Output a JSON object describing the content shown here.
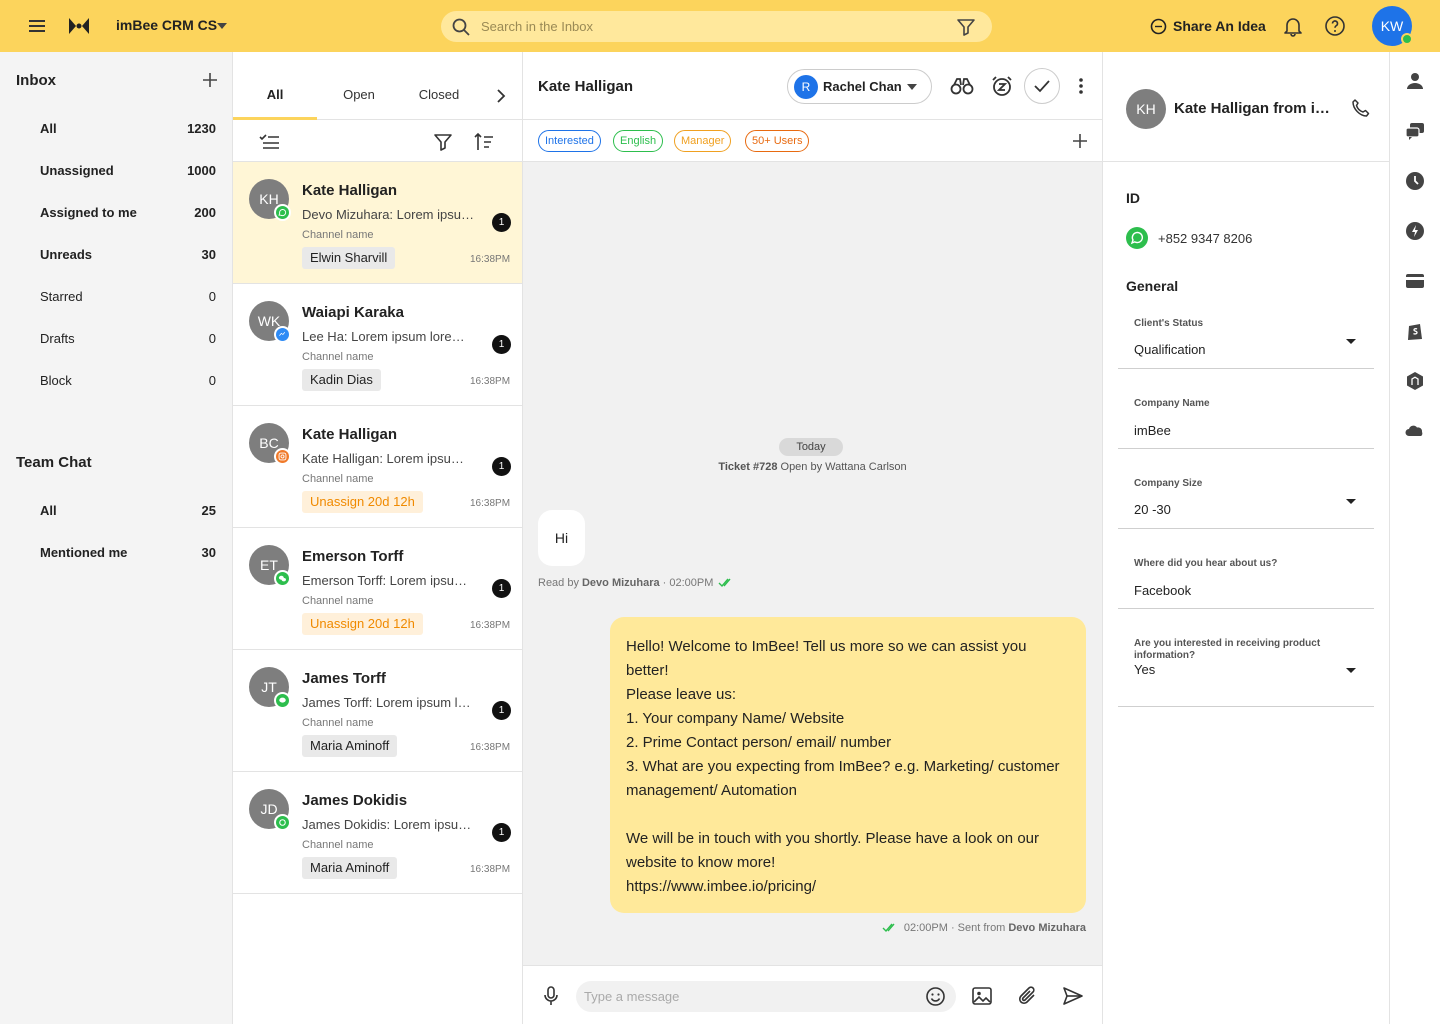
{
  "topbar": {
    "brand": "imBee CRM CS",
    "search_placeholder": "Search in the Inbox",
    "share_label": "Share An Idea",
    "avatar_initials": "KW",
    "bg_color": "#FCD45C"
  },
  "inbox": {
    "title": "Inbox",
    "items": [
      {
        "label": "All",
        "count": "1230"
      },
      {
        "label": "Unassigned",
        "count": "1000"
      },
      {
        "label": "Assigned to me",
        "count": "200"
      },
      {
        "label": "Unreads",
        "count": "30"
      },
      {
        "label": "Starred",
        "count": "0"
      },
      {
        "label": "Drafts",
        "count": "0"
      },
      {
        "label": "Block",
        "count": "0"
      }
    ]
  },
  "team_chat": {
    "title": "Team Chat",
    "items": [
      {
        "label": "All",
        "count": "25"
      },
      {
        "label": "Mentioned me",
        "count": "30"
      }
    ]
  },
  "list_tabs": [
    "All",
    "Open",
    "Closed"
  ],
  "conversations": [
    {
      "initials": "KH",
      "name": "Kate Halligan",
      "preview": "Devo Mizuhara: Lorem ipsum dolor sit amet",
      "channel": "Channel name",
      "tag": "Elwin Sharvill",
      "unread": "1",
      "time": "16:38PM",
      "badge_icon": "whatsapp-icon"
    },
    {
      "initials": "WK",
      "name": "Waiapi Karaka",
      "preview": "Lee Ha: Lorem ipsum lorem ipsum dolor",
      "channel": "Channel name",
      "tag": "Kadin Dias",
      "unread": "1",
      "time": "16:38PM",
      "badge_icon": "messenger-icon"
    },
    {
      "initials": "BC",
      "name": "Kate Halligan",
      "preview": "Kate Halligan: Lorem ipsum dolor sit amet",
      "channel": "Channel name",
      "tag": "Unassign 20d 12h",
      "unread": "1",
      "time": "16:38PM",
      "badge_icon": "instagram-icon"
    },
    {
      "initials": "ET",
      "name": "Emerson Torff",
      "preview": "Emerson Torff: Lorem ipsum dolor sit amet",
      "channel": "Channel name",
      "tag": "Unassign 20d 12h",
      "unread": "1",
      "time": "16:38PM",
      "badge_icon": "wechat-icon"
    },
    {
      "initials": "JT",
      "name": "James Torff",
      "preview": "James Torff: Lorem ipsum lorem ipsum",
      "channel": "Channel name",
      "tag": "Maria Aminoff",
      "unread": "1",
      "time": "16:38PM",
      "badge_icon": "line-icon"
    },
    {
      "initials": "JD",
      "name": "James Dokidis",
      "preview": "James Dokidis: Lorem ipsum dolor sit amet",
      "channel": "Channel name",
      "tag": "Maria Aminoff",
      "unread": "1",
      "time": "16:38PM",
      "badge_icon": "wechat-pay-icon"
    }
  ],
  "chat": {
    "contact_name": "Kate Halligan",
    "assignee_initial": "R",
    "assignee_name": "Rachel Chan",
    "tags": [
      {
        "label": "Interested",
        "color": "#1E73E8"
      },
      {
        "label": "English",
        "color": "#2DBE4D"
      },
      {
        "label": "Manager",
        "color": "#F0A020"
      },
      {
        "label": "50+ Users",
        "color": "#E86A10"
      }
    ],
    "day_label": "Today",
    "ticket_prefix": "Ticket #728",
    "ticket_suffix": " Open by Wattana Carlson",
    "incoming_text": "Hi",
    "incoming_meta_prefix": "Read by",
    "incoming_meta_name": "Devo Mizuhara",
    "incoming_meta_time": "· 02:00PM",
    "outgoing_text": " Hello! Welcome to ImBee! Tell us more so we can assist you better!\nPlease leave us:\n1. Your company Name/ Website\n2. Prime Contact person/ email/ number\n3. What are you expecting from ImBee? e.g. Marketing/ customer management/ Automation\n\nWe will be in touch with you shortly. Please have a look on our website to know more!\nhttps://www.imbee.io/pricing/",
    "outgoing_meta": "02:00PM · Sent from",
    "outgoing_meta_name": "Devo Mizuhara",
    "composer_placeholder": "Type a message"
  },
  "contact": {
    "initials": "KH",
    "name": "Kate Halligan from imBee",
    "id_title": "ID",
    "phone": "+852 9347 8206",
    "general_title": "General",
    "fields": [
      {
        "label": "Client's Status",
        "value": "Qualification",
        "dropdown": true
      },
      {
        "label": "Company Name",
        "value": "imBee",
        "dropdown": false
      },
      {
        "label": "Company Size",
        "value": "20 -30",
        "dropdown": true
      },
      {
        "label": "Where did you hear about us?",
        "value": "Facebook",
        "dropdown": false
      },
      {
        "label": "Are you interested in receiving product information?",
        "value": "Yes",
        "dropdown": true
      }
    ]
  }
}
